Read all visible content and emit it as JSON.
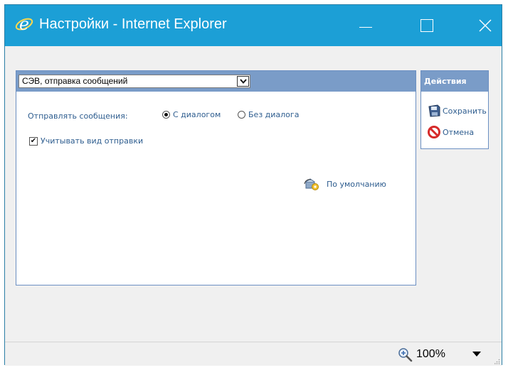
{
  "window": {
    "title": "Настройки - Internet Explorer"
  },
  "settings": {
    "select_value": "СЭВ, отправка сообщений",
    "send_messages_label": "Отправлять сообщения:",
    "radio_with_dialog": "С диалогом",
    "radio_without_dialog": "Без диалога",
    "selected_radio": "С диалогом",
    "consider_send_type_label": "Учитывать вид отправки",
    "consider_send_type_checked": true,
    "default_link": "По умолчанию"
  },
  "actions": {
    "header": "Действия",
    "save_label": "Сохранить",
    "cancel_label": "Отмена"
  },
  "status": {
    "zoom": "100%"
  },
  "colors": {
    "titlebar": "#1c9fd6",
    "panel_header": "#7a9cc8",
    "link_text": "#2e5d8f"
  },
  "icons": {
    "title": "internet-explorer-icon",
    "save": "floppy-disk-icon",
    "cancel": "prohibited-icon",
    "default": "reset-defaults-icon",
    "zoom": "zoom-in-icon"
  }
}
